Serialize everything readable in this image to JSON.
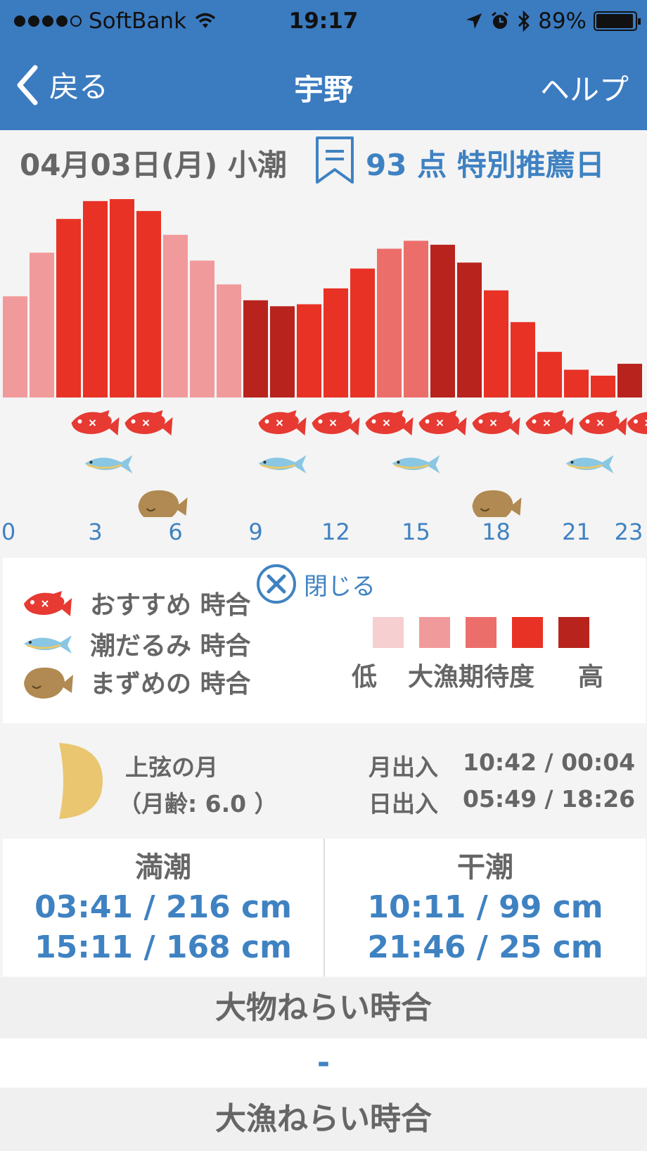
{
  "status": {
    "carrier": "SoftBank",
    "time": "19:17",
    "battery": "89%",
    "signal_bars": 4
  },
  "nav": {
    "back_label": "戻る",
    "title": "宇野",
    "help_label": "ヘルプ"
  },
  "header": {
    "date_tide": "04月03日(月) 小潮",
    "score_text": "93 点 特別推薦日"
  },
  "chart_data": {
    "type": "bar",
    "x": [
      0,
      1,
      2,
      3,
      4,
      5,
      6,
      7,
      8,
      9,
      10,
      11,
      12,
      13,
      14,
      15,
      16,
      17,
      18,
      19,
      20,
      21,
      22,
      23
    ],
    "values": [
      51,
      73,
      90,
      99,
      100,
      94,
      82,
      69,
      57,
      49,
      46,
      47,
      55,
      65,
      75,
      79,
      77,
      68,
      54,
      38,
      23,
      14,
      11,
      17
    ],
    "levels": [
      2,
      2,
      4,
      4,
      4,
      4,
      2,
      2,
      2,
      5,
      5,
      4,
      4,
      4,
      3,
      3,
      5,
      5,
      4,
      4,
      4,
      4,
      4,
      5
    ],
    "x_tick_labels": [
      "0",
      "3",
      "6",
      "9",
      "12",
      "15",
      "18",
      "21",
      "23"
    ],
    "colors": [
      "#f6cfd0",
      "#f19a9b",
      "#ec6e6b",
      "#e83225",
      "#b8231d"
    ],
    "red_fish_hours": [
      3,
      5,
      10,
      12,
      14,
      16,
      18,
      20,
      22,
      23.8
    ],
    "blue_fish_hours": [
      3.5,
      10,
      15,
      21.5
    ],
    "flounder_hours": [
      5.5,
      18
    ]
  },
  "legend": {
    "close_label": "閉じる",
    "items": [
      {
        "icon": "red-snapper-icon",
        "label": "おすすめ 時合"
      },
      {
        "icon": "blue-fish-icon",
        "label": "潮だるみ 時合"
      },
      {
        "icon": "flounder-icon",
        "label": "まずめの 時合"
      }
    ],
    "scale_low": "低",
    "scale_title": "大漁期待度",
    "scale_high": "高"
  },
  "moon": {
    "phase_name": "上弦の月",
    "age_text": "（月齢: 6.0 ）",
    "moon_label": "月出入",
    "moon_times": "10:42 / 00:04",
    "sun_label": "日出入",
    "sun_times": "05:49 / 18:26"
  },
  "tides": {
    "high_header": "満潮",
    "high": [
      "03:41 / 216 cm",
      "15:11 / 168 cm"
    ],
    "low_header": "干潮",
    "low": [
      "10:11 / 99 cm",
      "21:46 / 25 cm"
    ]
  },
  "sections": {
    "big_catch_header": "大物ねらい時合",
    "big_catch_value": "-",
    "haul_header": "大漁ねらい時合"
  }
}
